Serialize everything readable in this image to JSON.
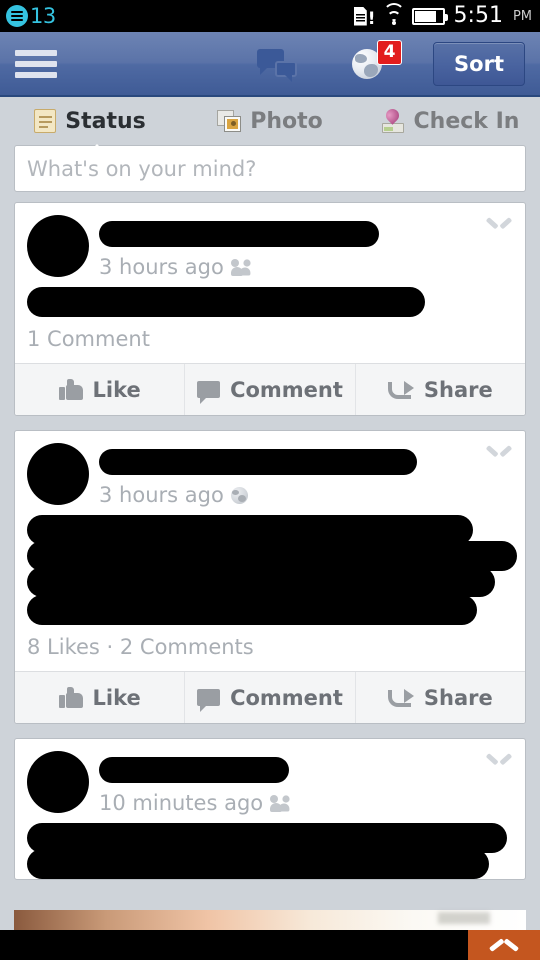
{
  "status_bar": {
    "notification_icon": "news-list-icon",
    "notification_count": "13",
    "sim_icon": "sim-card-alert-icon",
    "wifi_icon": "wifi-icon",
    "battery_icon": "battery-icon",
    "time": "5:51",
    "ampm": "PM",
    "accent_color": "#35c3e0",
    "background_color": "#000000"
  },
  "navbar": {
    "menu_icon": "hamburger-menu-icon",
    "friends_icon": "friend-requests-icon",
    "messages_icon": "messages-icon",
    "notifications_icon": "globe-notifications-icon",
    "notifications_badge": "4",
    "sort_label": "Sort",
    "brand_color": "#3b5998",
    "badge_color": "#e21d1d"
  },
  "tabs": [
    {
      "label": "Status",
      "icon": "note-icon",
      "active": true
    },
    {
      "label": "Photo",
      "icon": "photo-icon",
      "active": false
    },
    {
      "label": "Check In",
      "icon": "map-pin-icon",
      "active": false
    }
  ],
  "composer": {
    "value": "",
    "placeholder": "What's on your mind?"
  },
  "posts": [
    {
      "author_redacted": true,
      "time": "3 hours ago",
      "privacy_icon": "friends-privacy-icon",
      "content_lines": 1,
      "stats": "1 Comment",
      "menu_icon": "chevron-down-icon",
      "actions": [
        {
          "label": "Like",
          "icon": "thumbs-up-icon"
        },
        {
          "label": "Comment",
          "icon": "comment-bubble-icon"
        },
        {
          "label": "Share",
          "icon": "share-arrow-icon"
        }
      ]
    },
    {
      "author_redacted": true,
      "time": "3 hours ago",
      "privacy_icon": "public-globe-privacy-icon",
      "content_lines": 4,
      "stats": "8 Likes · 2 Comments",
      "menu_icon": "chevron-down-icon",
      "actions": [
        {
          "label": "Like",
          "icon": "thumbs-up-icon"
        },
        {
          "label": "Comment",
          "icon": "comment-bubble-icon"
        },
        {
          "label": "Share",
          "icon": "share-arrow-icon"
        }
      ]
    },
    {
      "author_redacted": true,
      "time": "10 minutes ago",
      "privacy_icon": "friends-privacy-icon",
      "content_lines": 2,
      "stats": "",
      "menu_icon": "chevron-down-icon",
      "actions": []
    }
  ],
  "bottom_bar": {
    "scroll_top_icon": "chevron-up-icon",
    "scroll_top_color": "#c4561f",
    "background_color": "#000000"
  },
  "theme": {
    "page_background": "#ced3d9",
    "card_background": "#ffffff",
    "card_border": "#b9bec4",
    "muted_text": "#a9aeb4",
    "action_text": "#6d7177"
  }
}
